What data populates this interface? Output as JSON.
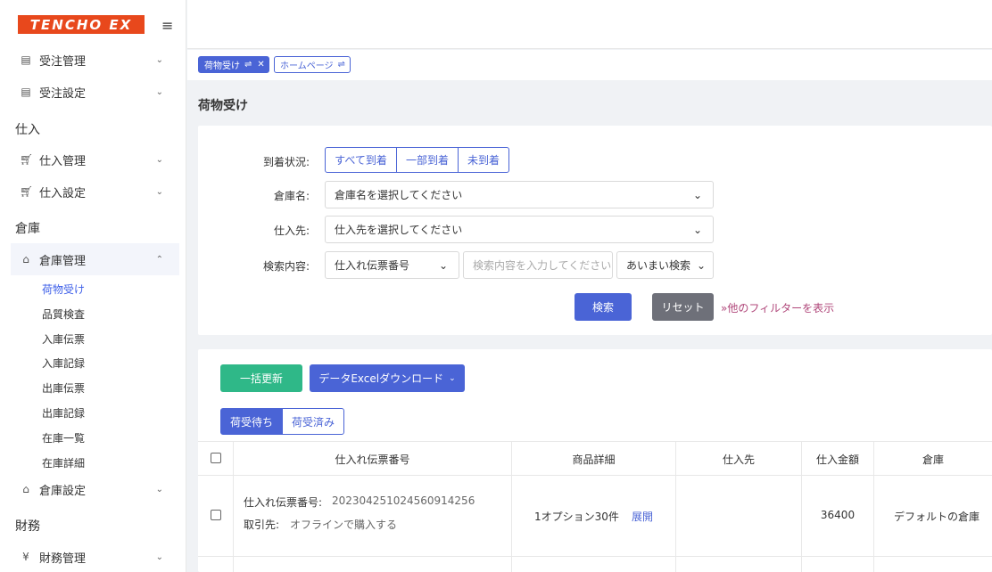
{
  "brand": {
    "logo_text": "TENCHO EX",
    "accent": "#e8481c",
    "primary": "#4a64d6",
    "success": "#2fb888",
    "secondary": "#6e7079"
  },
  "sidebar": {
    "items": [
      {
        "label": "受注管理",
        "icon": "clipboard-icon"
      },
      {
        "label": "受注設定",
        "icon": "clipboard-gear-icon"
      },
      {
        "section": "仕入"
      },
      {
        "label": "仕入管理",
        "icon": "cart-icon"
      },
      {
        "label": "仕入設定",
        "icon": "cart-gear-icon"
      },
      {
        "section": "倉庫"
      },
      {
        "label": "倉庫管理",
        "icon": "warehouse-icon"
      },
      {
        "label": "倉庫設定",
        "icon": "warehouse-gear-icon"
      },
      {
        "section": "財務"
      },
      {
        "label": "財務管理",
        "icon": "yen-coin-icon"
      }
    ],
    "section_shiire": "仕入",
    "section_souko": "倉庫",
    "section_zaimu": "財務",
    "sub_items": [
      "荷物受け",
      "品質検査",
      "入庫伝票",
      "入庫記録",
      "出庫伝票",
      "出庫記録",
      "在庫一覧",
      "在庫詳細"
    ]
  },
  "tags": [
    {
      "label": "荷物受け",
      "active": true
    },
    {
      "label": "ホームページ",
      "active": false
    }
  ],
  "page_title": "荷物受け",
  "filters": {
    "arrival_label": "到着状況:",
    "arrival_options": [
      "すべて到着",
      "一部到着",
      "未到着"
    ],
    "warehouse_label": "倉庫名:",
    "warehouse_placeholder": "倉庫名を選択してください",
    "supplier_label": "仕入先:",
    "supplier_placeholder": "仕入先を選択してください",
    "search_label": "検索内容:",
    "search_field_value": "仕入れ伝票番号",
    "search_input_placeholder": "検索内容を入力してください",
    "match_mode_value": "あいまい検索",
    "search_button": "検索",
    "reset_button": "リセット",
    "more_filters_link": "他のフィルターを表示"
  },
  "actions": {
    "bulk_update": "一括更新",
    "excel_download": "データExcelダウンロード"
  },
  "tabs": [
    "荷受待ち",
    "荷受済み"
  ],
  "table": {
    "headers": [
      "仕入れ伝票番号",
      "商品詳細",
      "仕入先",
      "仕入金額",
      "倉庫"
    ],
    "rows": [
      {
        "slip_label": "仕入れ伝票番号:",
        "slip_no": "20230425102456091425­6",
        "partner_label": "取引先:",
        "partner": "オフラインで購入する",
        "product": "1オプション30件",
        "expand": "展開",
        "supplier": "",
        "amount": "36400",
        "warehouse": "デフォルトの倉庫"
      }
    ]
  }
}
